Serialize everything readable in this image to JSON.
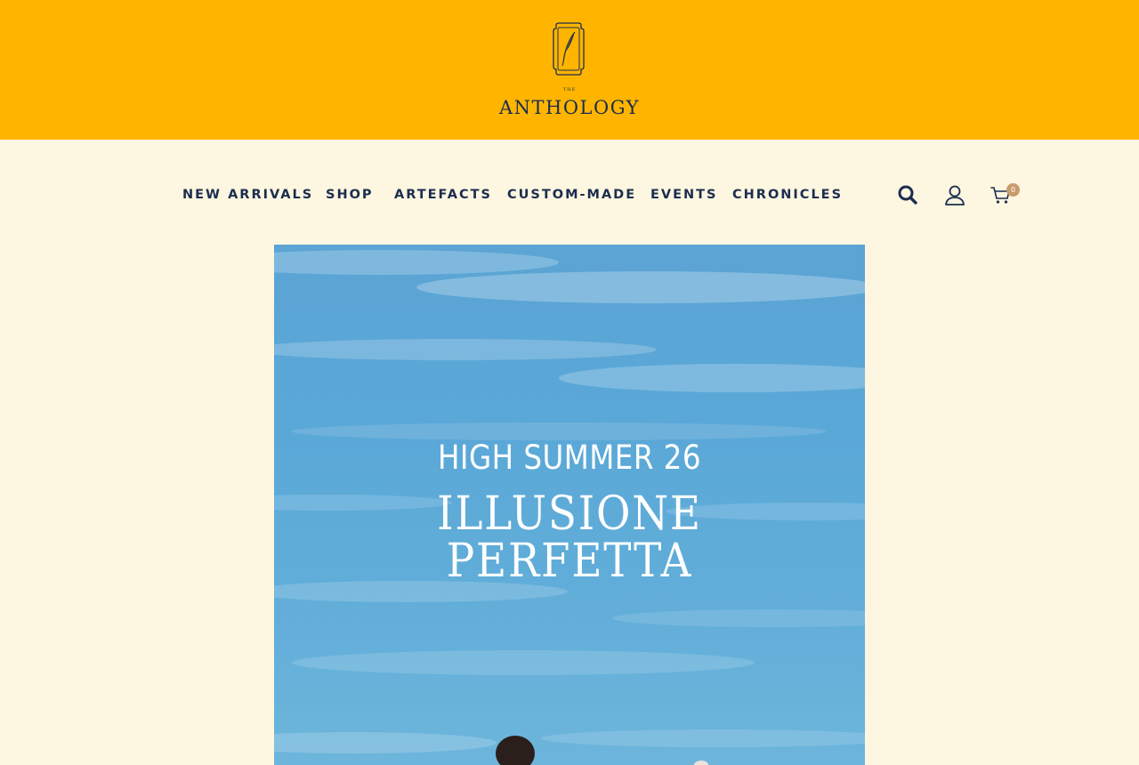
{
  "brand": {
    "small_text": "THE",
    "name": "ANTHOLOGY"
  },
  "nav": {
    "items": [
      {
        "label": "NEW ARRIVALS"
      },
      {
        "label": "SHOP"
      },
      {
        "label": "ARTEFACTS"
      },
      {
        "label": "CUSTOM-MADE"
      },
      {
        "label": "EVENTS"
      },
      {
        "label": "CHRONICLES"
      }
    ]
  },
  "icons": {
    "search": "search-icon",
    "account": "user-icon",
    "cart": "cart-icon"
  },
  "cart": {
    "count": "0"
  },
  "hero": {
    "season": "HIGH SUMMER 26",
    "title_line1": "ILLUSIONE",
    "title_line2": "PERFETTA"
  },
  "colors": {
    "banner": "#ffb500",
    "page_background": "#fdf6e0",
    "navy": "#1b2d4f",
    "badge": "#c89b6c",
    "sky": "#5aa8d8"
  }
}
